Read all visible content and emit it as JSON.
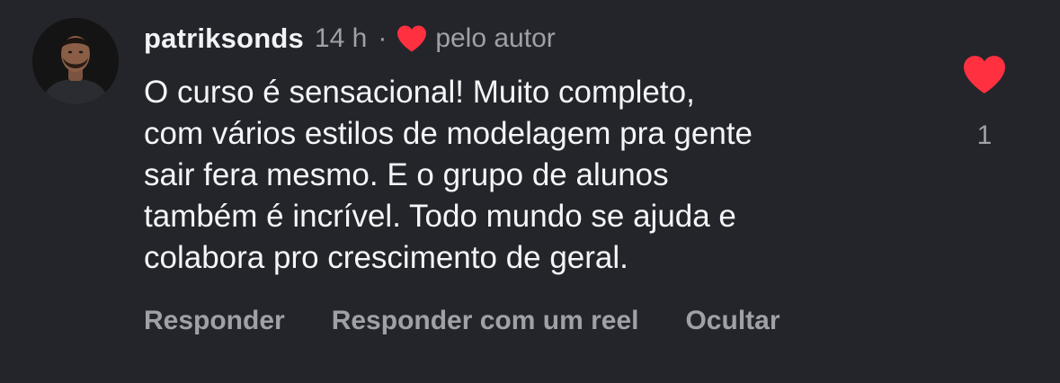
{
  "comment": {
    "username": "patriksonds",
    "time": "14 h",
    "separator": "·",
    "liked_by_author": "pelo autor",
    "text": "O curso é sensacional! Muito completo, com vários estilos de modelagem pra gente sair fera mesmo. E o grupo de alunos também é incrível. Todo mundo se ajuda e colabora pro crescimento de geral.",
    "text_lines": [
      "O curso é sensacional! Muito completo,",
      "com vários estilos de modelagem pra gente",
      "sair fera mesmo. E o grupo de alunos",
      "também é incrível. Todo mundo se ajuda e",
      "colabora pro crescimento de geral."
    ],
    "like_count": "1",
    "liked": true
  },
  "actions": {
    "reply": "Responder",
    "reply_reel": "Responder com um reel",
    "hide": "Ocultar"
  },
  "icons": {
    "author_heart": "heart-icon",
    "like": "heart-filled-icon"
  },
  "colors": {
    "background": "#24252b",
    "heart": "#ff3040",
    "muted_text": "#9ea1a8",
    "primary_text": "#f4f5f7"
  }
}
